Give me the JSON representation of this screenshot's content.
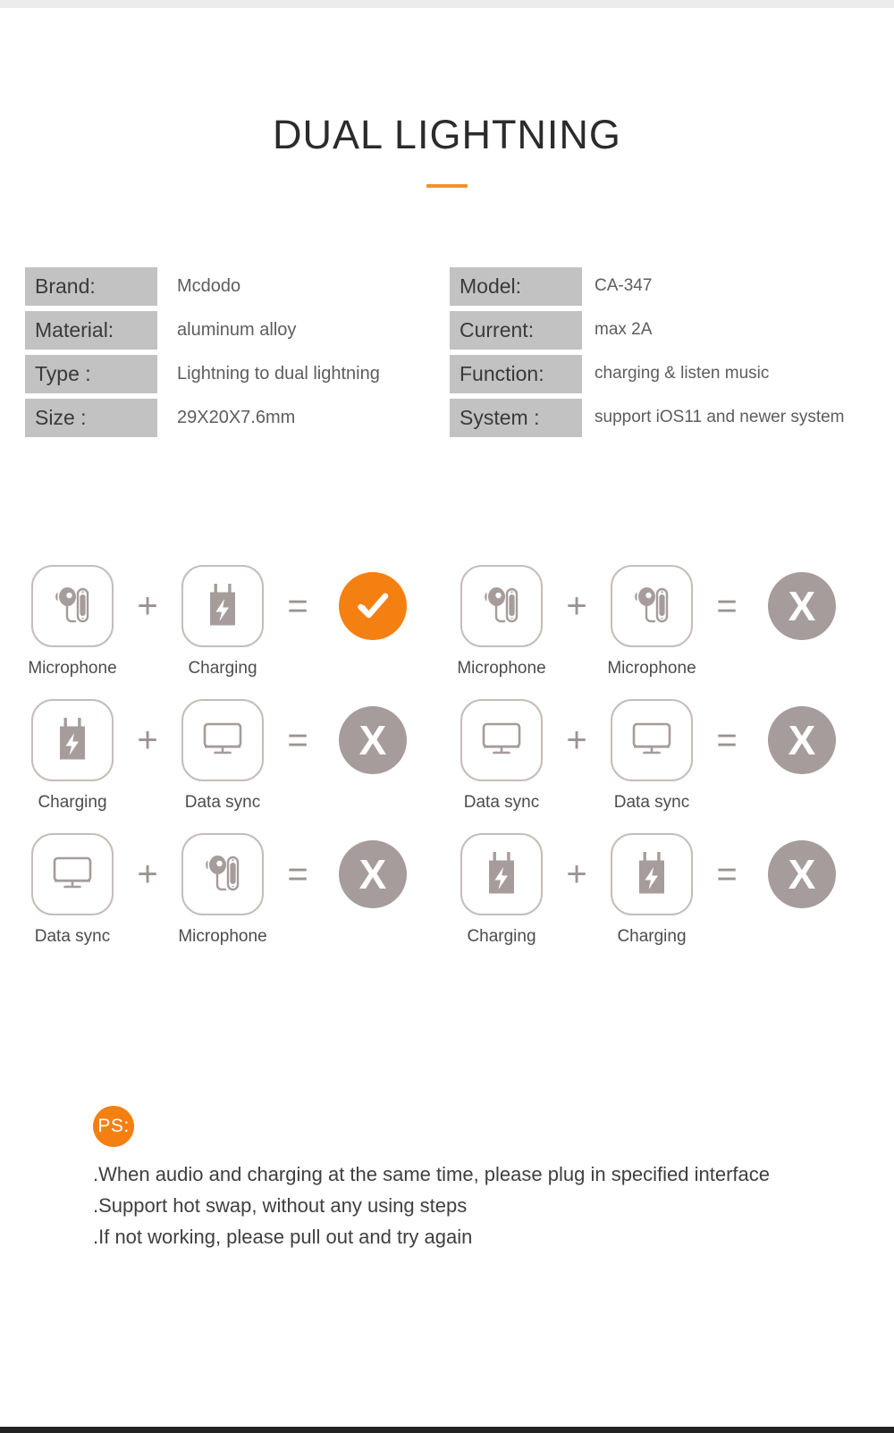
{
  "header": {
    "title": "DUAL LIGHTNING"
  },
  "colors": {
    "accent_orange": "#f58012",
    "divider_orange": "#f3912c",
    "key_box_gray": "#c2c2c2",
    "icon_gray": "#a59c9b",
    "tile_border": "#c5bcbb",
    "body_text": "#4c4c4c",
    "top_strip": "#ececec",
    "bottom_strip": "#232323"
  },
  "specs": {
    "left": [
      {
        "key": "Brand:",
        "value": "Mcdodo"
      },
      {
        "key": "Material:",
        "value": "aluminum alloy"
      },
      {
        "key": "Type :",
        "value": "Lightning to dual lightning"
      },
      {
        "key": "Size :",
        "value": "29X20X7.6mm"
      }
    ],
    "right": [
      {
        "key": "Model:",
        "value": "CA-347"
      },
      {
        "key": "Current:",
        "value": "max 2A"
      },
      {
        "key": "Function:",
        "value": "charging & listen music"
      },
      {
        "key": "System :",
        "value": "support iOS11 and newer system"
      }
    ]
  },
  "matrix": {
    "operator_plus": "+",
    "operator_equals": "=",
    "result_fail_glyph": "X",
    "rows": [
      {
        "left": {
          "a": {
            "label": "Microphone",
            "icon": "earphone-icon"
          },
          "b": {
            "label": "Charging",
            "icon": "charger-icon"
          },
          "result": "ok"
        },
        "right": {
          "a": {
            "label": "Microphone",
            "icon": "earphone-icon"
          },
          "b": {
            "label": "Microphone",
            "icon": "earphone-icon"
          },
          "result": "no"
        }
      },
      {
        "left": {
          "a": {
            "label": "Charging",
            "icon": "charger-icon"
          },
          "b": {
            "label": "Data sync",
            "icon": "monitor-icon"
          },
          "result": "no"
        },
        "right": {
          "a": {
            "label": "Data sync",
            "icon": "monitor-icon"
          },
          "b": {
            "label": "Data sync",
            "icon": "monitor-icon"
          },
          "result": "no"
        }
      },
      {
        "left": {
          "a": {
            "label": "Data sync",
            "icon": "monitor-icon"
          },
          "b": {
            "label": "Microphone",
            "icon": "earphone-icon"
          },
          "result": "no"
        },
        "right": {
          "a": {
            "label": "Charging",
            "icon": "charger-icon"
          },
          "b": {
            "label": "Charging",
            "icon": "charger-icon"
          },
          "result": "no"
        }
      }
    ]
  },
  "notes": {
    "badge": "PS:",
    "lines": [
      ".When audio and charging at the same time, please plug in specified interface",
      ".Support hot swap, without any using steps",
      ".If not working, please pull out and try again"
    ]
  }
}
